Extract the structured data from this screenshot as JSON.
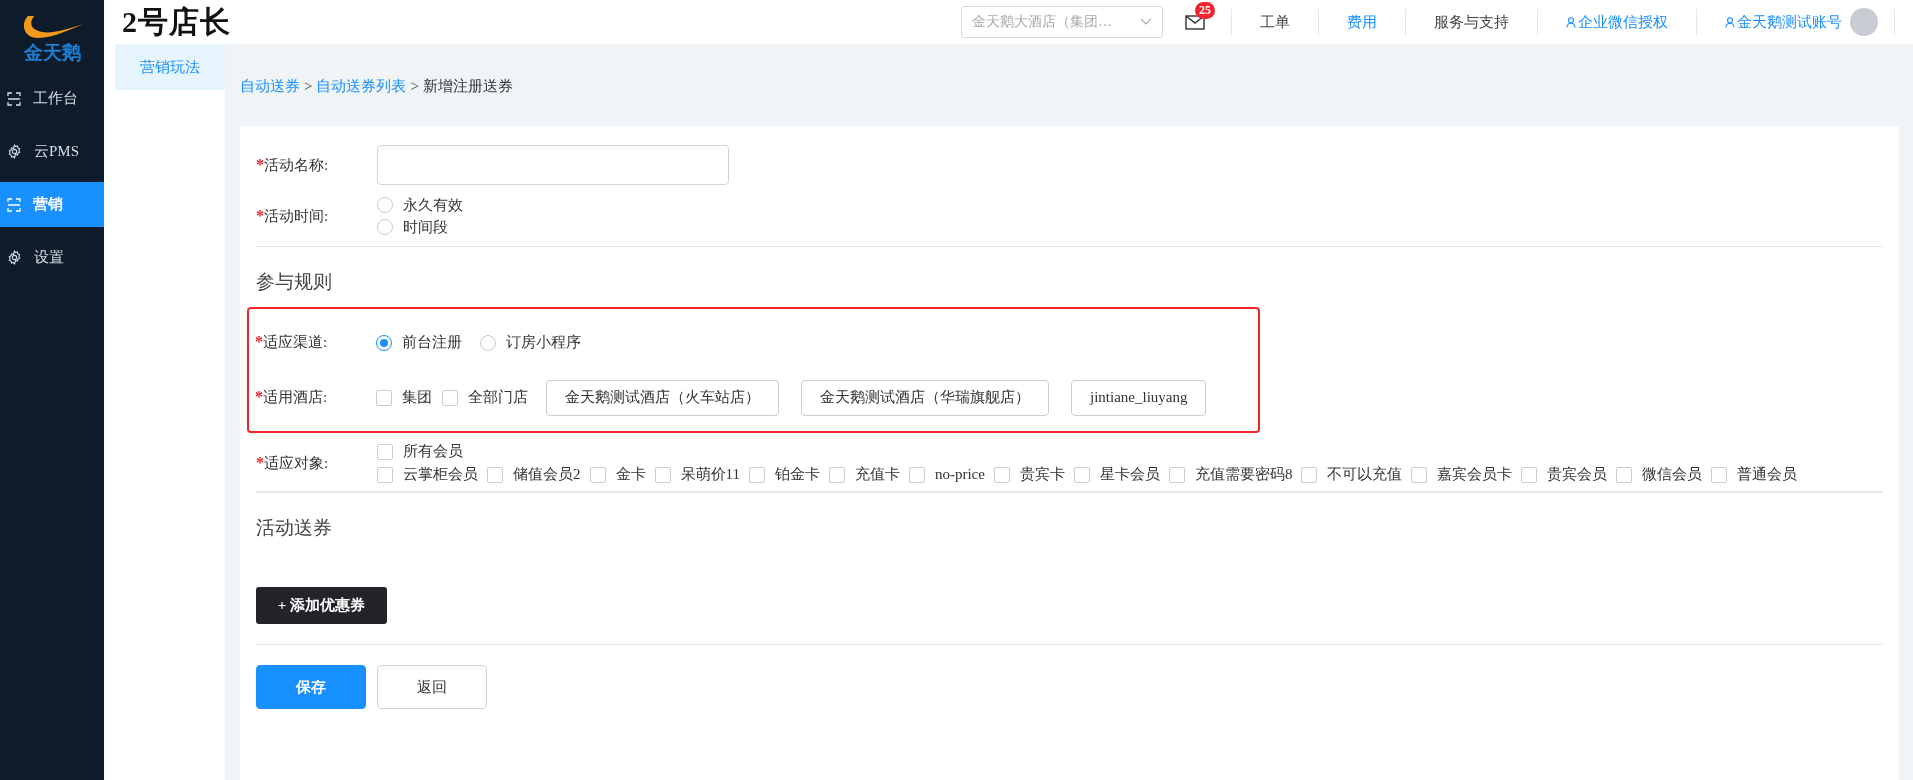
{
  "brand": {
    "logo_text": "金天鹅",
    "app_title": "2号店长"
  },
  "sidebar": {
    "items": [
      {
        "label": "工作台",
        "kind": "frame",
        "selected": false
      },
      {
        "label": "云PMS",
        "kind": "gear",
        "selected": false
      },
      {
        "label": "营销",
        "kind": "frame",
        "selected": true
      },
      {
        "label": "设置",
        "kind": "gear",
        "selected": false
      }
    ]
  },
  "topbar": {
    "store_select": {
      "value": "金天鹅大酒店（集团…"
    },
    "notifications": {
      "badge": "25"
    },
    "links": [
      {
        "label": "工单",
        "kind": "plain"
      },
      {
        "label": "费用",
        "kind": "active"
      },
      {
        "label": "服务与支持",
        "kind": "plain"
      },
      {
        "label": "企业微信授权",
        "kind": "user"
      },
      {
        "label": "金天鹅测试账号",
        "kind": "account"
      }
    ]
  },
  "subnav": {
    "items": [
      {
        "label": "营销玩法",
        "selected": true
      }
    ]
  },
  "breadcrumb": {
    "separator": ">",
    "items": [
      {
        "label": "自动送券",
        "link": true
      },
      {
        "label": "自动送券列表",
        "link": true
      },
      {
        "label": "新增注册送券",
        "link": false
      }
    ]
  },
  "required_mark": "*",
  "sections": [
    {
      "highlighted": false,
      "fields": [
        {
          "kind": "text",
          "label": "活动名称:",
          "required": true
        },
        {
          "kind": "radio_vertical",
          "label": "活动时间:",
          "required": true,
          "options": [
            {
              "label": "永久有效",
              "selected": false
            },
            {
              "label": "时间段",
              "selected": false
            }
          ]
        }
      ]
    },
    {
      "title": "参与规则",
      "highlighted": true,
      "fields": [
        {
          "kind": "radio_inline",
          "label": "适应渠道:",
          "required": true,
          "options": [
            {
              "label": "前台注册",
              "selected": true
            },
            {
              "label": "订房小程序",
              "selected": false
            }
          ]
        },
        {
          "kind": "hotels",
          "label": "适用酒店:",
          "required": true,
          "options": [
            {
              "label": "集团",
              "checked": false
            },
            {
              "label": "全部门店",
              "checked": false
            }
          ],
          "tags": [
            "金天鹅测试酒店（火车站店）",
            "金天鹅测试酒店（华瑞旗舰店）",
            "jintiane_liuyang"
          ]
        }
      ]
    },
    {
      "highlighted": false,
      "fields": [
        {
          "kind": "checkbox",
          "label": "适应对象:",
          "required": true,
          "option_rows": [
            [
              {
                "label": "所有会员",
                "checked": false
              }
            ],
            [
              {
                "label": "云掌柜会员",
                "checked": false
              },
              {
                "label": "储值会员2",
                "checked": false
              },
              {
                "label": "金卡",
                "checked": false
              },
              {
                "label": "呆萌价11",
                "checked": false
              },
              {
                "label": "铂金卡",
                "checked": false
              },
              {
                "label": "充值卡",
                "checked": false
              },
              {
                "label": "no-price",
                "checked": false
              },
              {
                "label": "贵宾卡",
                "checked": false
              },
              {
                "label": "星卡会员",
                "checked": false
              },
              {
                "label": "充值需要密码8",
                "checked": false
              },
              {
                "label": "不可以充值",
                "checked": false
              },
              {
                "label": "嘉宾会员卡",
                "checked": false
              },
              {
                "label": "贵宾会员",
                "checked": false
              },
              {
                "label": "微信会员",
                "checked": false
              },
              {
                "label": "普通会员",
                "checked": false
              }
            ]
          ]
        }
      ]
    },
    {
      "title": "活动送券",
      "highlighted": false,
      "add_button": "+ 添加优惠券"
    }
  ],
  "actions": [
    {
      "label": "保存",
      "kind": "primary"
    },
    {
      "label": "返回",
      "kind": "default"
    }
  ]
}
